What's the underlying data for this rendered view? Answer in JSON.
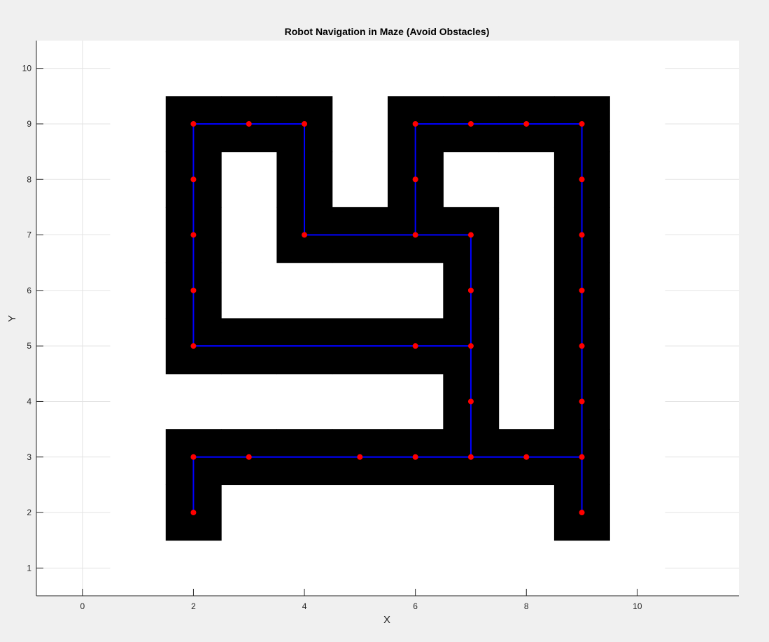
{
  "chart_data": {
    "type": "scatter",
    "title": "Robot Navigation in Maze (Avoid Obstacles)",
    "xlabel": "X",
    "ylabel": "Y",
    "xlim": [
      -0.83,
      11.83
    ],
    "ylim": [
      0.5,
      10.5
    ],
    "xticks": [
      0,
      2,
      4,
      6,
      8,
      10
    ],
    "yticks": [
      1,
      2,
      3,
      4,
      5,
      6,
      7,
      8,
      9,
      10
    ],
    "grid": true,
    "colors": {
      "background": "#f0f0f0",
      "axes": "#ffffff",
      "obstacle": "#000000",
      "path": "#0000ff",
      "node": "#ff0000",
      "grid": "#e3e3e3",
      "axis_line": "#262626",
      "text": "#262626"
    },
    "maze_extent": {
      "x": [
        0.5,
        10.5
      ],
      "y": [
        0.5,
        10.5
      ]
    },
    "obstacle_cells": [
      [
        2,
        2
      ],
      [
        9,
        2
      ],
      [
        2,
        3
      ],
      [
        3,
        3
      ],
      [
        4,
        3
      ],
      [
        5,
        3
      ],
      [
        6,
        3
      ],
      [
        7,
        3
      ],
      [
        8,
        3
      ],
      [
        9,
        3
      ],
      [
        7,
        4
      ],
      [
        9,
        4
      ],
      [
        2,
        5
      ],
      [
        3,
        5
      ],
      [
        4,
        5
      ],
      [
        5,
        5
      ],
      [
        6,
        5
      ],
      [
        7,
        5
      ],
      [
        9,
        5
      ],
      [
        2,
        6
      ],
      [
        7,
        6
      ],
      [
        9,
        6
      ],
      [
        2,
        7
      ],
      [
        4,
        7
      ],
      [
        5,
        7
      ],
      [
        6,
        7
      ],
      [
        7,
        7
      ],
      [
        9,
        7
      ],
      [
        2,
        8
      ],
      [
        4,
        8
      ],
      [
        6,
        8
      ],
      [
        9,
        8
      ],
      [
        2,
        9
      ],
      [
        3,
        9
      ],
      [
        4,
        9
      ],
      [
        6,
        9
      ],
      [
        7,
        9
      ],
      [
        8,
        9
      ],
      [
        9,
        9
      ]
    ],
    "path_segments": [
      [
        [
          2,
          2
        ],
        [
          2,
          3
        ]
      ],
      [
        [
          2,
          3
        ],
        [
          9,
          3
        ]
      ],
      [
        [
          9,
          2
        ],
        [
          9,
          9
        ]
      ],
      [
        [
          7,
          3
        ],
        [
          7,
          7
        ]
      ],
      [
        [
          2,
          5
        ],
        [
          7,
          5
        ]
      ],
      [
        [
          2,
          5
        ],
        [
          2,
          9
        ]
      ],
      [
        [
          2,
          9
        ],
        [
          4,
          9
        ]
      ],
      [
        [
          4,
          9
        ],
        [
          4,
          7
        ]
      ],
      [
        [
          4,
          7
        ],
        [
          7,
          7
        ]
      ],
      [
        [
          6,
          7
        ],
        [
          6,
          9
        ]
      ],
      [
        [
          6,
          9
        ],
        [
          9,
          9
        ]
      ]
    ],
    "nodes": [
      [
        2,
        2
      ],
      [
        9,
        2
      ],
      [
        2,
        3
      ],
      [
        3,
        3
      ],
      [
        5,
        3
      ],
      [
        6,
        3
      ],
      [
        7,
        3
      ],
      [
        8,
        3
      ],
      [
        9,
        3
      ],
      [
        7,
        4
      ],
      [
        9,
        4
      ],
      [
        2,
        5
      ],
      [
        6,
        5
      ],
      [
        7,
        5
      ],
      [
        9,
        5
      ],
      [
        2,
        6
      ],
      [
        7,
        6
      ],
      [
        9,
        6
      ],
      [
        2,
        7
      ],
      [
        4,
        7
      ],
      [
        6,
        7
      ],
      [
        7,
        7
      ],
      [
        9,
        7
      ],
      [
        2,
        8
      ],
      [
        6,
        8
      ],
      [
        9,
        8
      ],
      [
        2,
        9
      ],
      [
        3,
        9
      ],
      [
        4,
        9
      ],
      [
        6,
        9
      ],
      [
        7,
        9
      ],
      [
        8,
        9
      ],
      [
        9,
        9
      ]
    ]
  }
}
